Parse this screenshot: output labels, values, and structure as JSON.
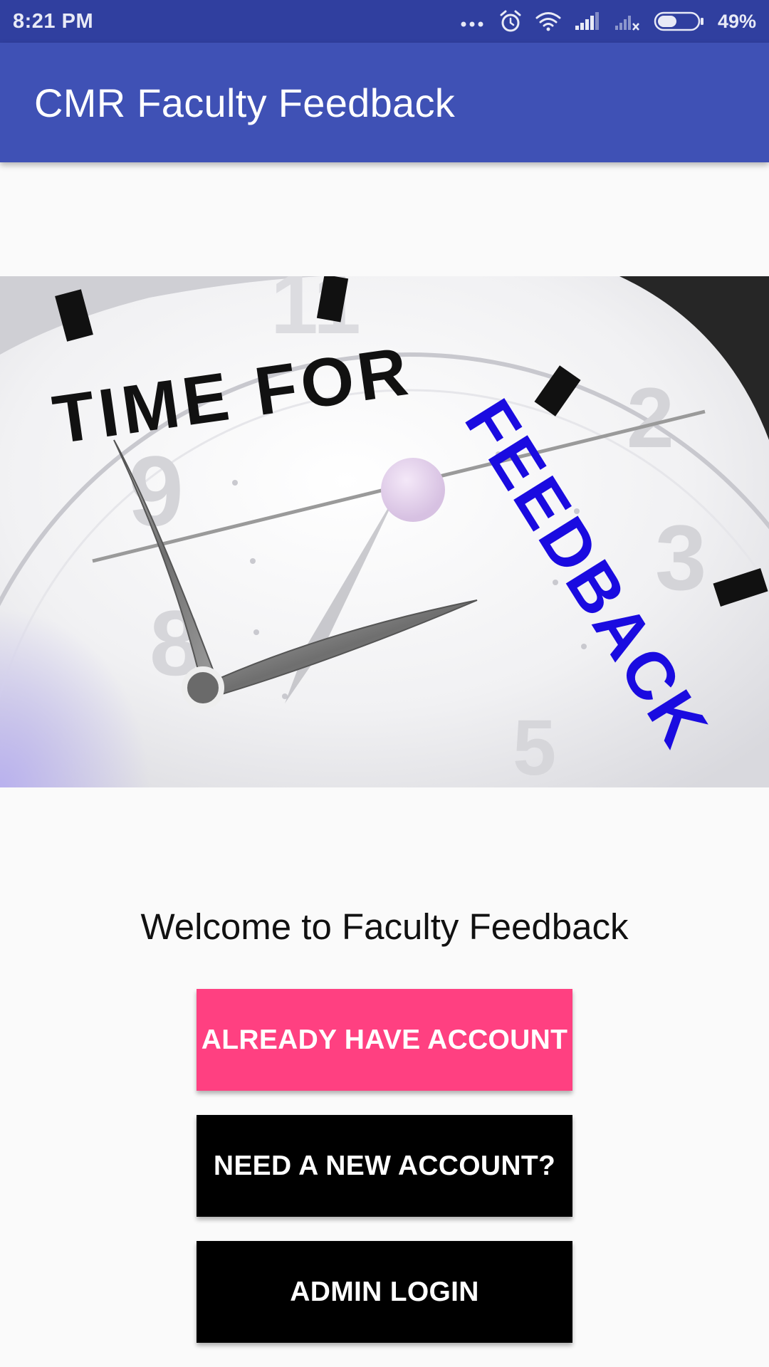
{
  "status_bar": {
    "time": "8:21 PM",
    "battery_percent": "49%",
    "icons": [
      "more-dots-icon",
      "alarm-icon",
      "wifi-icon",
      "signal-icon",
      "signal-no-sim-icon",
      "battery-icon"
    ],
    "battery_level": 0.49
  },
  "app_bar": {
    "title": "CMR Faculty Feedback"
  },
  "hero": {
    "text_line1": "TIME FOR",
    "text_line2": "FEEDBACK"
  },
  "main": {
    "welcome_text": "Welcome to Faculty Feedback",
    "buttons": {
      "login": "ALREADY HAVE ACCOUNT",
      "register": "NEED A NEW ACCOUNT?",
      "admin": "ADMIN LOGIN"
    }
  },
  "colors": {
    "status_bar": "#303f9f",
    "primary": "#3f51b5",
    "accent": "#ff4081",
    "feedback_text": "#1a0be0"
  }
}
